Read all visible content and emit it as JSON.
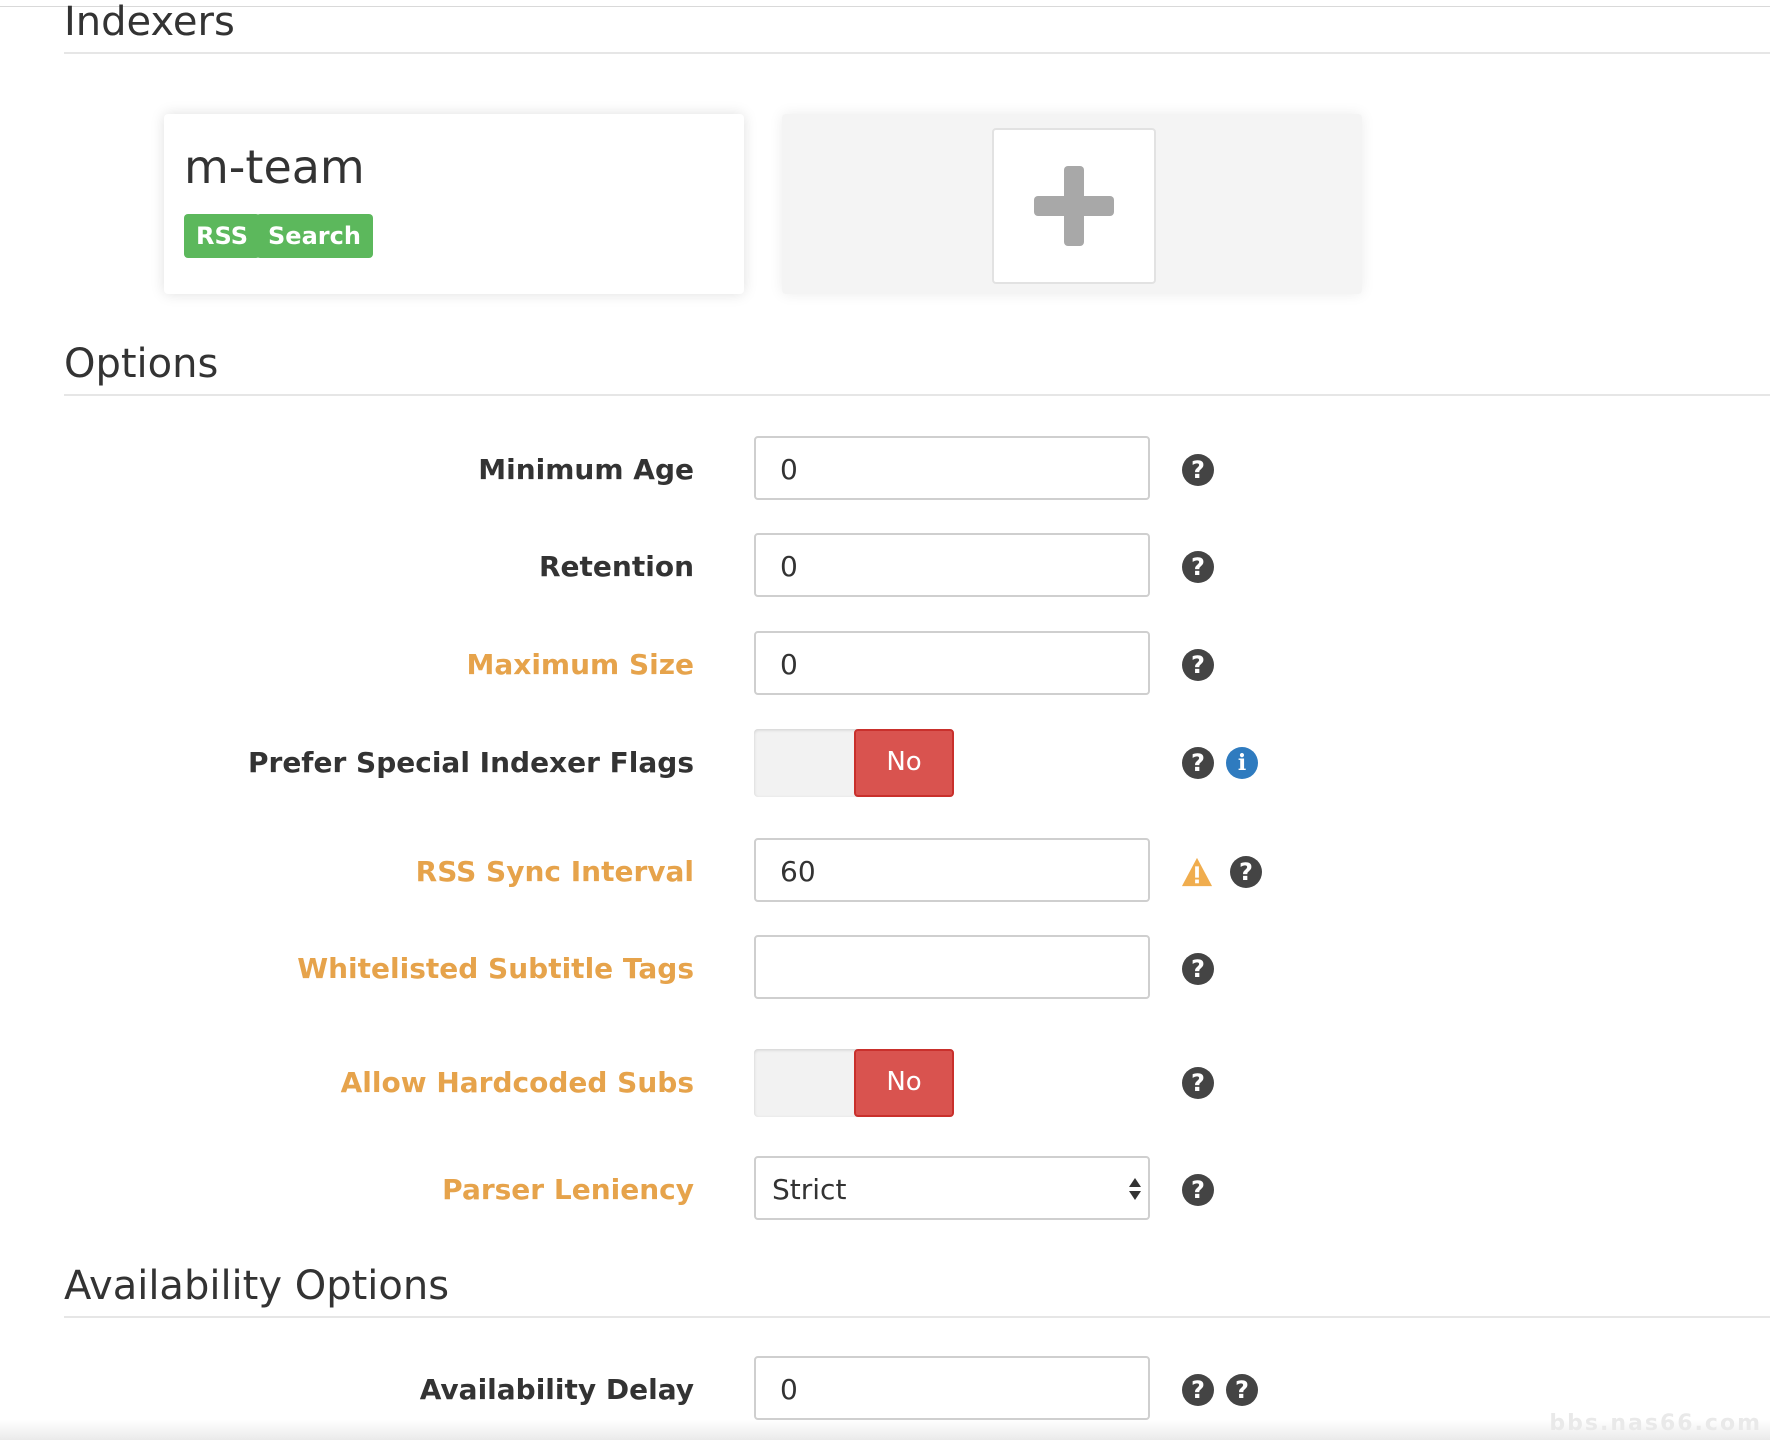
{
  "sections": {
    "indexers_title": "Indexers",
    "options_title": "Options",
    "availability_title": "Availability Options"
  },
  "indexer": {
    "name": "m-team",
    "badges": [
      "RSS",
      "Search"
    ]
  },
  "add_indexer": {
    "icon": "plus-icon"
  },
  "options": {
    "minimum_age": {
      "label": "Minimum Age",
      "value": "0"
    },
    "retention": {
      "label": "Retention",
      "value": "0"
    },
    "maximum_size": {
      "label": "Maximum Size",
      "value": "0"
    },
    "prefer_special_flags": {
      "label": "Prefer Special Indexer Flags",
      "state": "No"
    },
    "rss_sync_interval": {
      "label": "RSS Sync Interval",
      "value": "60"
    },
    "whitelisted_subtitle_tags": {
      "label": "Whitelisted Subtitle Tags",
      "value": ""
    },
    "allow_hardcoded_subs": {
      "label": "Allow Hardcoded Subs",
      "state": "No"
    },
    "parser_leniency": {
      "label": "Parser Leniency",
      "value": "Strict"
    }
  },
  "availability": {
    "availability_delay": {
      "label": "Availability Delay",
      "value": "0"
    }
  },
  "icons": {
    "help": "?",
    "info": "i",
    "warning": "!"
  },
  "watermark": "bbs.nas66.com",
  "colors": {
    "advanced_label": "#e6a34b",
    "badge_green": "#5cb85c",
    "toggle_no_red": "#d9534f",
    "info_blue": "#2f7bbf",
    "warning_orange": "#f0ad4e"
  }
}
